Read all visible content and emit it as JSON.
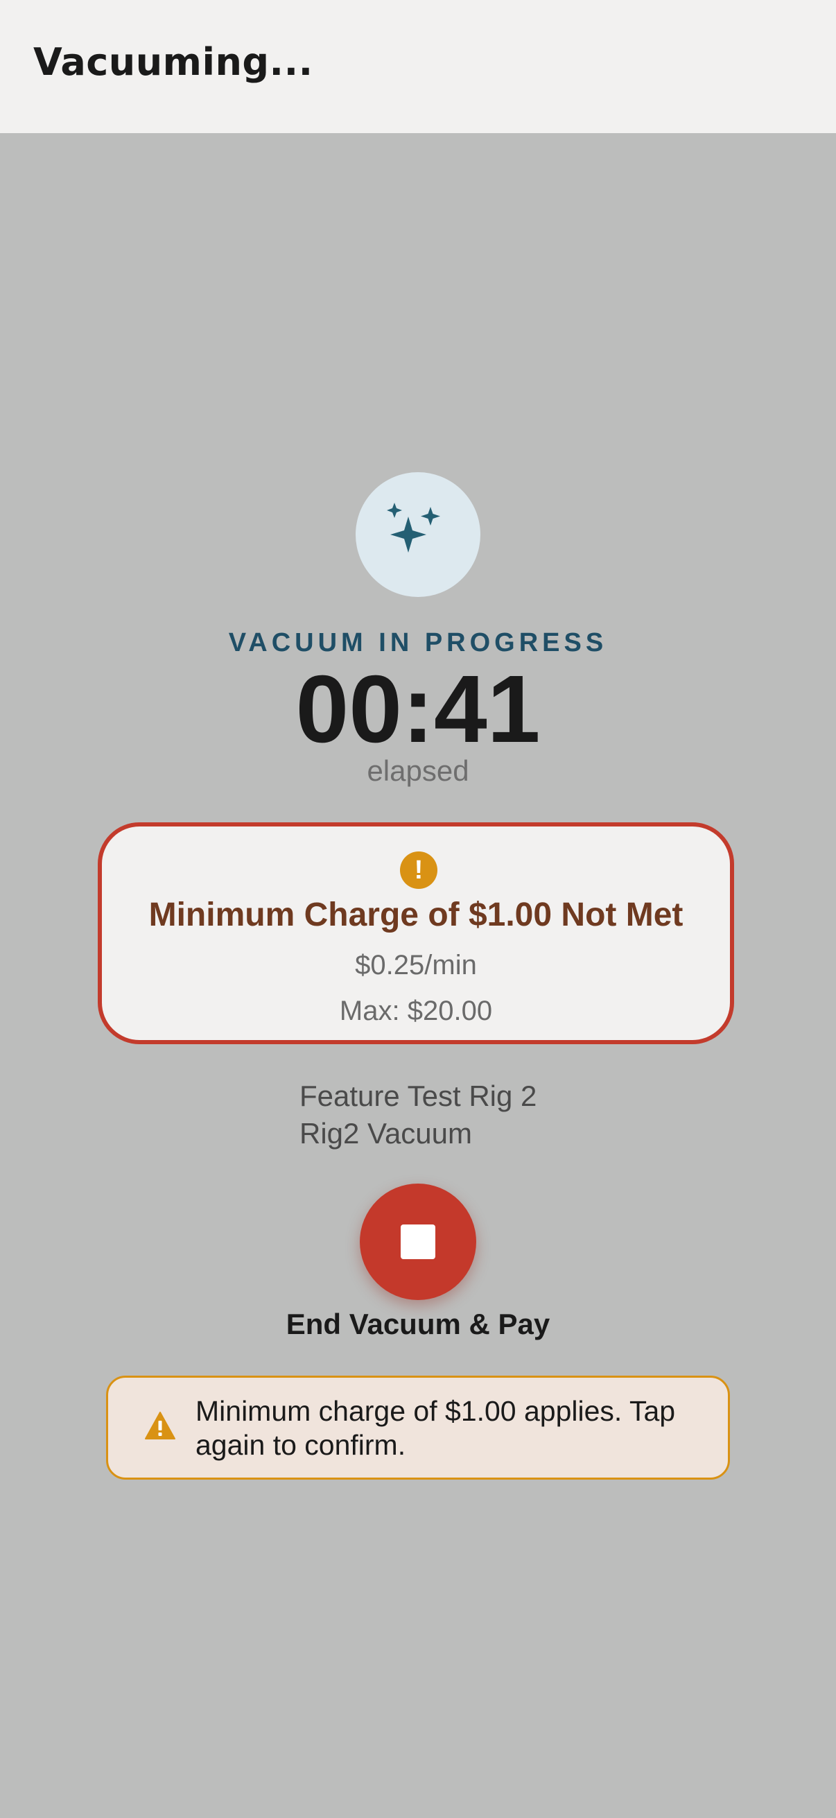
{
  "header": {
    "title": "Vacuuming..."
  },
  "session": {
    "icon": "sparkles-icon",
    "status_label": "VACUUM IN PROGRESS",
    "timer": "00:41",
    "elapsed_label": "elapsed"
  },
  "charge_card": {
    "icon": "exclamation-icon",
    "title": "Minimum Charge of $1.00 Not Met",
    "rate": "$0.25/min",
    "max": "Max: $20.00"
  },
  "location": {
    "site": "Feature Test Rig 2",
    "station": "Rig2 Vacuum"
  },
  "actions": {
    "end_icon": "stop-icon",
    "end_label": "End Vacuum & Pay"
  },
  "toast": {
    "icon": "warning-triangle-icon",
    "message": "Minimum charge of $1.00 applies. Tap again to confirm."
  },
  "colors": {
    "background": "#bcbdbc",
    "header_bg": "#f2f1f0",
    "accent_teal": "#1f4e66",
    "danger_red": "#c4392b",
    "warning_amber": "#d99214",
    "card_title_brown": "#6f3a20"
  }
}
